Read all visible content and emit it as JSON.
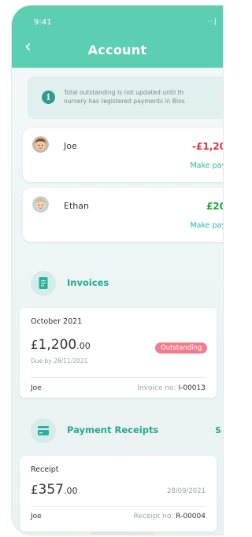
{
  "status": {
    "time": "9:41",
    "signal": "··❘"
  },
  "header": {
    "back": "‹",
    "title": "Account"
  },
  "notice": {
    "line1": "Total outstanding is not updated until th",
    "line2": "nursery has registered payments in Blos"
  },
  "children": [
    {
      "name": "Joe",
      "amount": "-£1,20",
      "action": "Make pay",
      "amount_color": "#e2323f"
    },
    {
      "name": "Ethan",
      "amount": "£20",
      "action": "Make pay",
      "amount_color": "#23a63b"
    }
  ],
  "invoices": {
    "title": "Invoices",
    "card": {
      "period": "October 2021",
      "currency": "£",
      "amount_main": "1,200",
      "amount_cents": ".00",
      "due": "Due by 28/11/2021",
      "status": "Outstanding",
      "child": "Joe",
      "ref_label": "Invoice no: ",
      "ref_value": "I-00013"
    }
  },
  "receipts": {
    "title": "Payment Receipts",
    "side_letter": "S",
    "card": {
      "label": "Receipt",
      "currency": "£",
      "amount_main": "357",
      "amount_cents": ".00",
      "date": "28/09/2021",
      "child": "Joe",
      "ref_label": "Receipt no: ",
      "ref_value": "R-00004"
    }
  }
}
